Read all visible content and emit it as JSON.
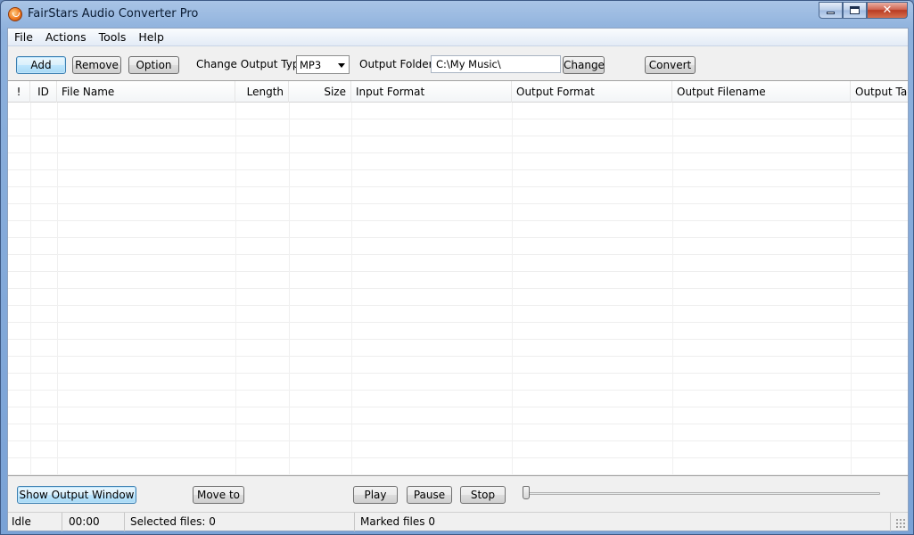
{
  "window": {
    "title": "FairStars Audio Converter Pro",
    "close_glyph": "✕"
  },
  "menu": [
    "File",
    "Actions",
    "Tools",
    "Help"
  ],
  "toolbar": {
    "add": "Add",
    "remove": "Remove",
    "option": "Option",
    "output_type_label": "Change Output Type:",
    "output_type_value": "MP3",
    "output_folder_label": "Output Folder:",
    "output_folder_value": "C:\\My Music\\",
    "change": "Change",
    "convert": "Convert"
  },
  "columns": [
    "!",
    "ID",
    "File Name",
    "Length",
    "Size",
    "Input Format",
    "Output Format",
    "Output Filename",
    "Output Tag"
  ],
  "controls": {
    "show_output": "Show Output Window",
    "move_to": "Move to",
    "play": "Play",
    "pause": "Pause",
    "stop": "Stop",
    "position": 0
  },
  "status": {
    "state": "Idle",
    "time": "00:00",
    "selected": "Selected files: 0",
    "marked": "Marked files 0"
  },
  "colors": {
    "accent": "#3c7fb1",
    "close_red": "#c74a30"
  },
  "icons": {
    "app": "audio-converter-icon",
    "minimize": "minimize-icon",
    "maximize": "maximize-icon",
    "close": "close-icon",
    "dropdown": "chevron-down-icon"
  }
}
